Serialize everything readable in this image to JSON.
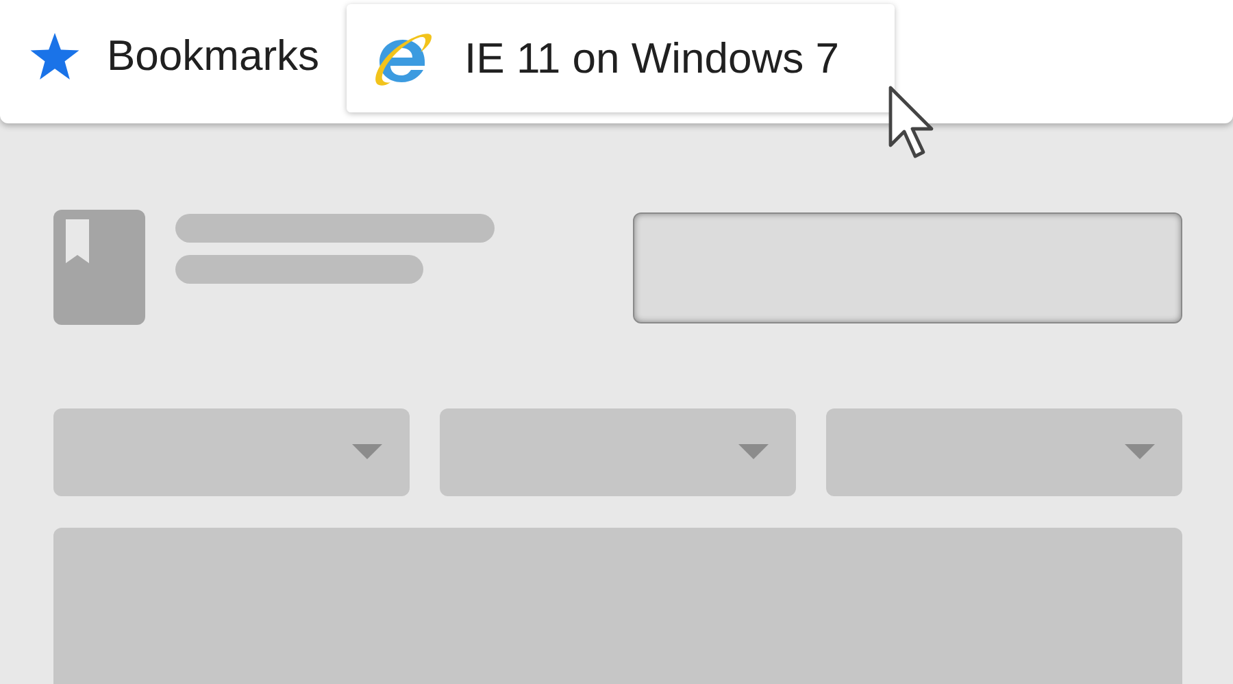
{
  "bookmarks_bar": {
    "title": "Bookmarks",
    "items": [
      {
        "label": "IE 11 on Windows 7",
        "selected": true
      }
    ]
  }
}
